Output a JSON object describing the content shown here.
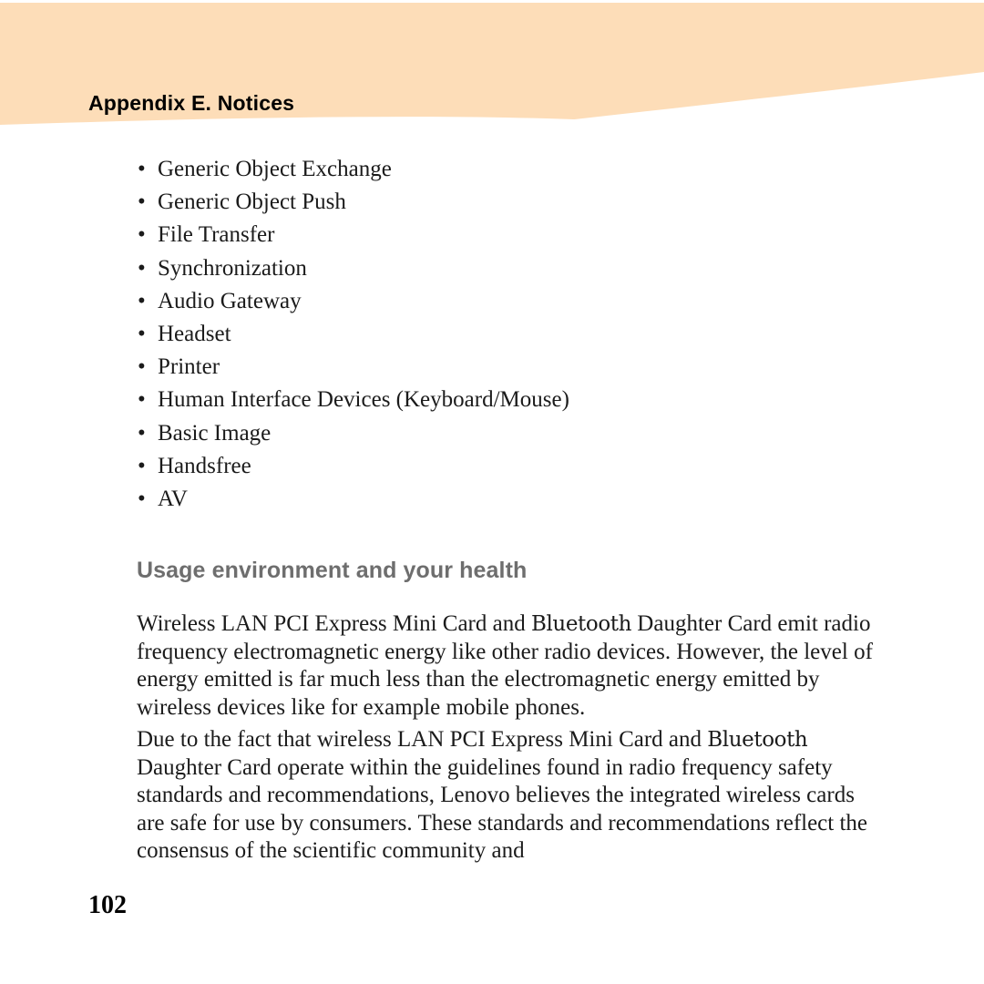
{
  "header": {
    "title": "Appendix E. Notices",
    "band_color": "#fdddb8",
    "title_color": "#000000"
  },
  "bullets": [
    {
      "marker": "•",
      "label": "Generic Object Exchange"
    },
    {
      "marker": "•",
      "label": "Generic Object Push"
    },
    {
      "marker": "•",
      "label": "File Transfer"
    },
    {
      "marker": "•",
      "label": "Synchronization"
    },
    {
      "marker": "•",
      "label": "Audio Gateway"
    },
    {
      "marker": "•",
      "label": "Headset"
    },
    {
      "marker": "•",
      "label": "Printer"
    },
    {
      "marker": "•",
      "label": "Human Interface Devices (Keyboard/Mouse)"
    },
    {
      "marker": "•",
      "label": "Basic Image"
    },
    {
      "marker": "•",
      "label": "Handsfree"
    },
    {
      "marker": "•",
      "label": "AV"
    }
  ],
  "section": {
    "heading": "Usage environment and your health",
    "heading_color": "#6e6e6e",
    "paragraph_1_part_1": "Wireless LAN PCI Express Mini Card and ",
    "paragraph_1_brand": "Bluetooth",
    "paragraph_1_part_2": " Daughter Card emit radio frequency electromagnetic energy like other radio devices. However, the level of energy emitted is far much less than the electromagnetic energy emitted by wireless devices like for example mobile phones.",
    "paragraph_2_part_1": "Due to the fact that wireless LAN PCI Express Mini Card and ",
    "paragraph_2_brand": "Bluetooth",
    "paragraph_2_part_2": " Daughter Card operate within the guidelines found in radio frequency safety standards and recommendations, Lenovo believes the integrated wireless cards are safe for use by consumers. These standards and recommendations reflect the consensus of the scientific community and"
  },
  "footer": {
    "page_number": "102"
  }
}
